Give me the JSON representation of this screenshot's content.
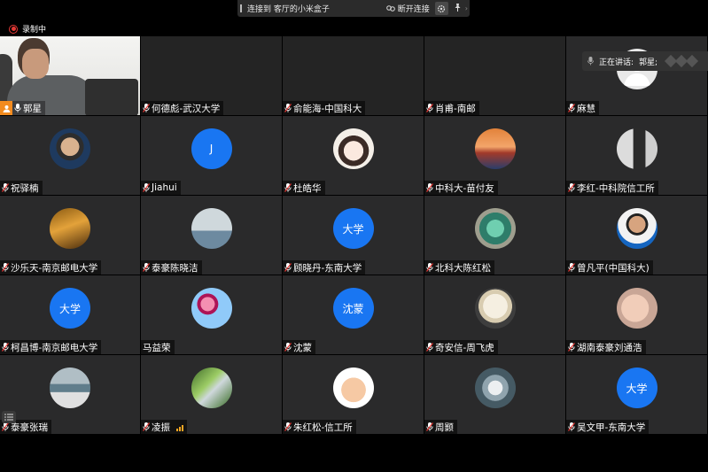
{
  "topbar": {
    "title": "连接到 客厅的小米盒子",
    "disconnect_label": "断开连接"
  },
  "recording": {
    "label": "录制中"
  },
  "speaking": {
    "prefix": "正在讲话:",
    "name": "郭星;"
  },
  "colors": {
    "avatar_blue": "#1976f2",
    "host_orange": "#f28b1f",
    "record_red": "#e53935",
    "tile_bg": "#2a2a2b"
  },
  "tiles": [
    {
      "name": "郭星",
      "kind": "video"
    },
    {
      "name": "何德彪-武汉大学",
      "kind": "empty"
    },
    {
      "name": "俞能海-中国科大",
      "kind": "empty"
    },
    {
      "name": "肖甫-南邮",
      "kind": "empty"
    },
    {
      "name": "麻慧",
      "kind": "photo",
      "icon": "avatar-default-icon"
    },
    {
      "name": "祝驿楠",
      "kind": "photo",
      "icon": "avatar-young-man-icon"
    },
    {
      "name": "Jiahui",
      "kind": "letter",
      "text": "J"
    },
    {
      "name": "杜皓华",
      "kind": "photo",
      "icon": "avatar-cartoon-girl-icon"
    },
    {
      "name": "中科大-苗付友",
      "kind": "photo",
      "icon": "avatar-sunset-icon"
    },
    {
      "name": "李红-中科院信工所",
      "kind": "photo",
      "icon": "avatar-suited-man-icon"
    },
    {
      "name": "沙乐天-南京邮电大学",
      "kind": "photo",
      "icon": "avatar-golden-scene-icon"
    },
    {
      "name": "泰豪陈晓洁",
      "kind": "photo",
      "icon": "avatar-woman-outdoor-icon"
    },
    {
      "name": "顾晓丹-东南大学",
      "kind": "letter",
      "text": "大学"
    },
    {
      "name": "北科大陈红松",
      "kind": "photo",
      "icon": "avatar-green-orb-icon"
    },
    {
      "name": "曾凡平(中国科大)",
      "kind": "photo",
      "icon": "avatar-man-portrait-icon"
    },
    {
      "name": "柯昌博-南京邮电大学",
      "kind": "letter",
      "text": "大学"
    },
    {
      "name": "马益荣",
      "kind": "photo",
      "icon": "avatar-pink-flowers-icon"
    },
    {
      "name": "沈蒙",
      "kind": "letter",
      "text": "沈蒙"
    },
    {
      "name": "奇安信-周飞虎",
      "kind": "photo",
      "icon": "avatar-plush-toy-icon"
    },
    {
      "name": "湖南泰豪刘通浩",
      "kind": "photo",
      "icon": "avatar-baby-icon"
    },
    {
      "name": "泰豪张瑞",
      "kind": "photo",
      "icon": "avatar-beach-icon"
    },
    {
      "name": "凌振",
      "kind": "photo",
      "icon": "avatar-river-valley-icon",
      "signal": true
    },
    {
      "name": "朱红松-信工所",
      "kind": "photo",
      "icon": "avatar-tintin-icon"
    },
    {
      "name": "周颢",
      "kind": "photo",
      "icon": "avatar-crystal-icon"
    },
    {
      "name": "吴文甲-东南大学",
      "kind": "letter",
      "text": "大学"
    }
  ]
}
